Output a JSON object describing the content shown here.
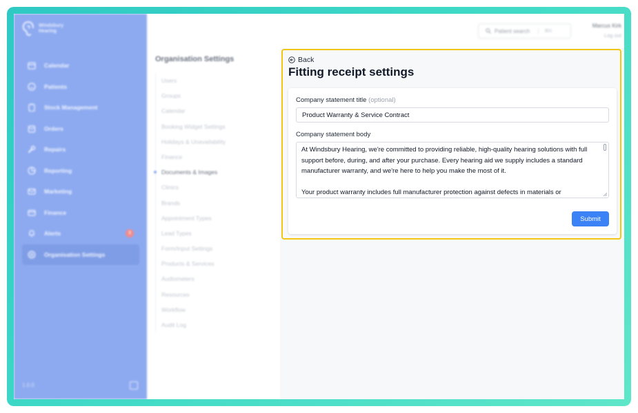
{
  "brand": {
    "name": "Windsbury Hearing"
  },
  "sidebar": {
    "items": [
      {
        "label": "Calendar",
        "icon": "calendar-icon"
      },
      {
        "label": "Patients",
        "icon": "smile-icon"
      },
      {
        "label": "Stock Management",
        "icon": "clipboard-icon"
      },
      {
        "label": "Orders",
        "icon": "box-icon"
      },
      {
        "label": "Repairs",
        "icon": "wrench-icon"
      },
      {
        "label": "Reporting",
        "icon": "pie-icon"
      },
      {
        "label": "Marketing",
        "icon": "mail-icon"
      },
      {
        "label": "Finance",
        "icon": "card-icon"
      },
      {
        "label": "Alerts",
        "icon": "bell-icon",
        "badge": "3"
      },
      {
        "label": "Organisation Settings",
        "icon": "gear-icon",
        "active": true
      }
    ],
    "version": "1.0.0"
  },
  "header": {
    "search_placeholder": "Patient search",
    "search_shortcut": "⌘K",
    "user_name": "Marcus Kirk",
    "logout_label": "Log out"
  },
  "settings_nav": {
    "title": "Organisation Settings",
    "items": [
      "Users",
      "Groups",
      "Calendar",
      "Booking Widget Settings",
      "Holidays & Unavailability",
      "Finance",
      "Documents & Images",
      "Clinics",
      "Brands",
      "Appointment Types",
      "Lead Types",
      "Form/Input Settings",
      "Products & Services",
      "Audiometers",
      "Resources",
      "Workflow",
      "Audit Log"
    ],
    "current": "Documents & Images"
  },
  "main": {
    "back_label": "Back",
    "title": "Fitting receipt settings",
    "form": {
      "title_label": "Company statement title",
      "title_optional": "(optional)",
      "title_value": "Product Warranty & Service Contract",
      "body_label": "Company statement body",
      "body_value": "At Windsbury Hearing, we're committed to providing reliable, high-quality hearing solutions with full support before, during, and after your purchase. Every hearing aid we supply includes a standard manufacturer warranty, and we're here to help you make the most of it.\n\nYour product warranty includes full manufacturer protection against defects in materials or",
      "submit_label": "Submit"
    }
  },
  "colors": {
    "frame_gradient_start": "#2ec9c3",
    "sidebar": "#8daaf0",
    "highlight": "#f3c614",
    "primary_button": "#3b82f6"
  }
}
